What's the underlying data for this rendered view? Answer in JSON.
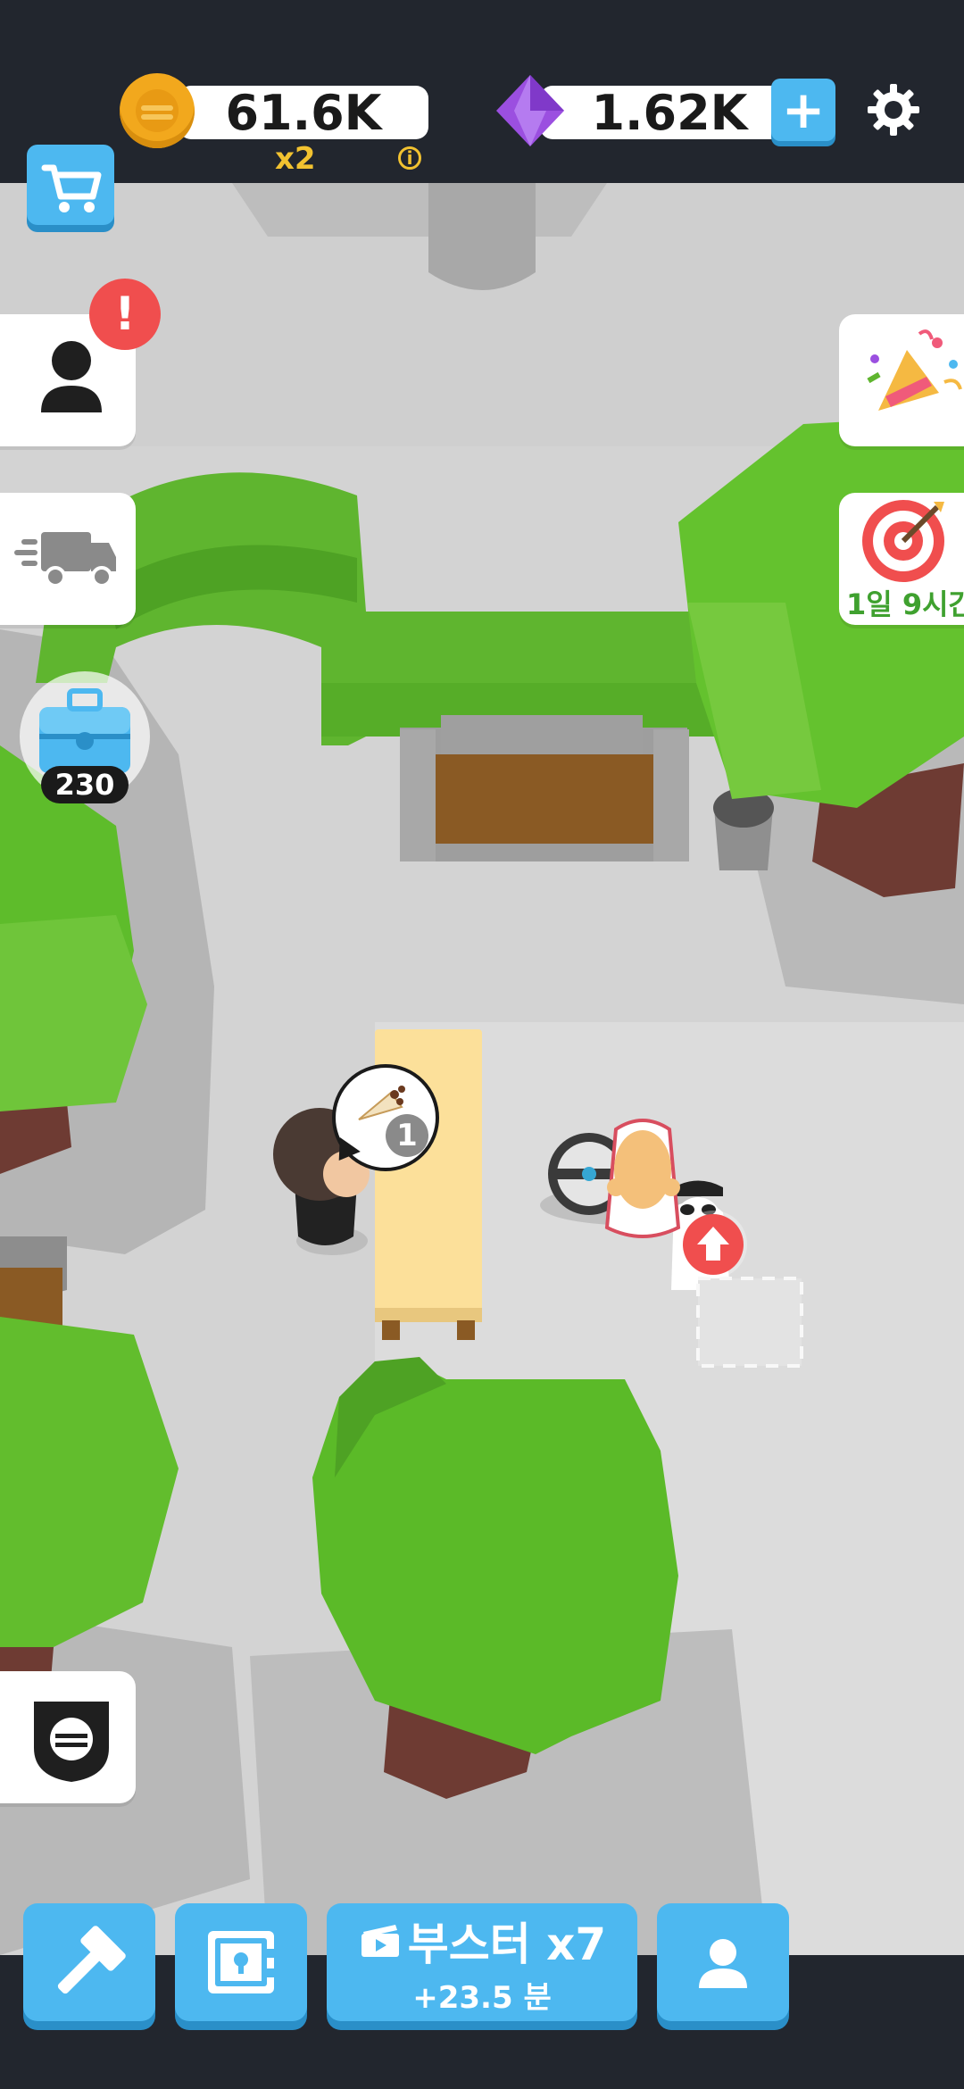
{
  "hud": {
    "coins": "61.6K",
    "multiplier": "x2",
    "info_symbol": "i",
    "gems": "1.62K",
    "add_symbol": "+"
  },
  "side": {
    "chest_count": "230",
    "alert_symbol": "!",
    "event_timer": "1일 9시간"
  },
  "order": {
    "quantity": "1"
  },
  "bottom": {
    "booster_label": "부스터 x7",
    "booster_time": "+23.5 분"
  },
  "colors": {
    "accent_blue": "#4db8f0",
    "coin_gold": "#f2a81d",
    "gem_purple": "#9b4fe0",
    "alert_red": "#f04e4e",
    "timer_green": "#3fa12f",
    "tree_green": "#6cc23a"
  }
}
